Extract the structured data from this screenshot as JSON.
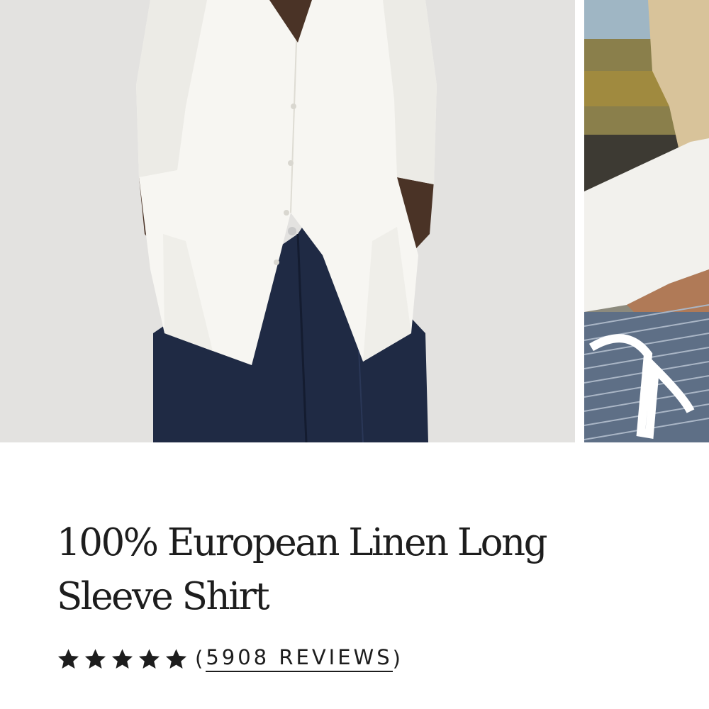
{
  "product": {
    "title": "100% European Linen Long Sleeve Shirt",
    "rating": {
      "stars": 5,
      "max_stars": 5,
      "reviews_text": "5908 REVIEWS",
      "open_paren": "(",
      "close_paren": ")"
    }
  },
  "gallery": {
    "images": [
      {
        "name": "model-white-linen-shirt-jeans"
      },
      {
        "name": "model-linen-shirt-outdoor-partial"
      }
    ]
  },
  "colors": {
    "text": "#1d1d1d",
    "background": "#ffffff",
    "star": "#1d1d1d"
  }
}
